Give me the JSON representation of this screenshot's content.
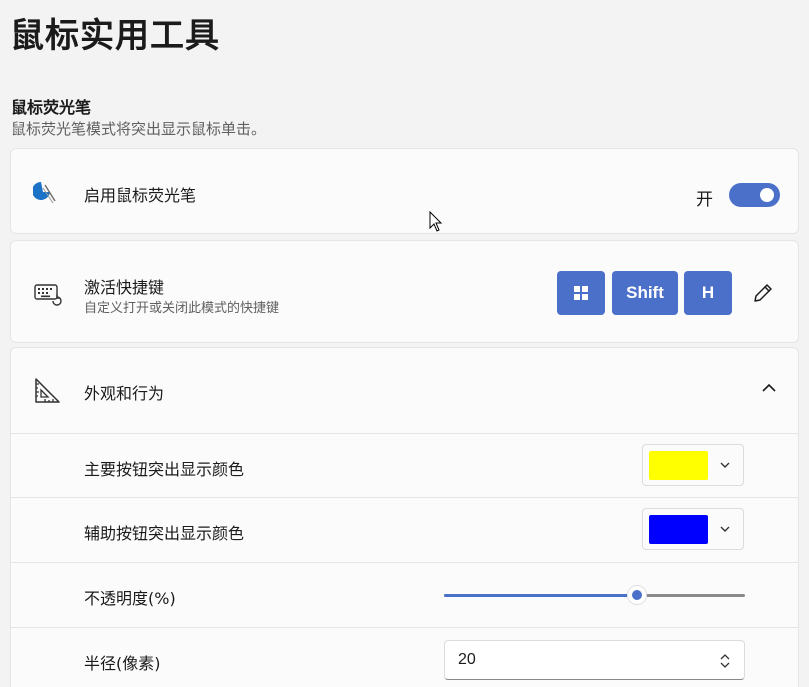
{
  "page": {
    "title": "鼠标实用工具"
  },
  "section": {
    "title": "鼠标荧光笔",
    "description": "鼠标荧光笔模式将突出显示鼠标单击。"
  },
  "enable": {
    "icon": "highlighter-icon",
    "label": "启用鼠标荧光笔",
    "state_label": "开",
    "enabled": true
  },
  "shortcut": {
    "icon": "keyboard-icon",
    "label": "激活快捷键",
    "description": "自定义打开或关闭此模式的快捷键",
    "keys": [
      "Win",
      "Shift",
      "H"
    ],
    "edit_icon": "pencil-icon"
  },
  "appearance": {
    "icon": "ruler-triangle-icon",
    "label": "外观和行为",
    "expanded": true,
    "primary_color": {
      "label": "主要按钮突出显示颜色",
      "color": "#FFFF00"
    },
    "secondary_color": {
      "label": "辅助按钮突出显示颜色",
      "color": "#0000FF"
    },
    "opacity": {
      "label": "不透明度(%)",
      "value_fraction": 0.64
    },
    "radius": {
      "label": "半径(像素)",
      "value": "20"
    }
  },
  "colors": {
    "accent": "#4A70C9"
  }
}
